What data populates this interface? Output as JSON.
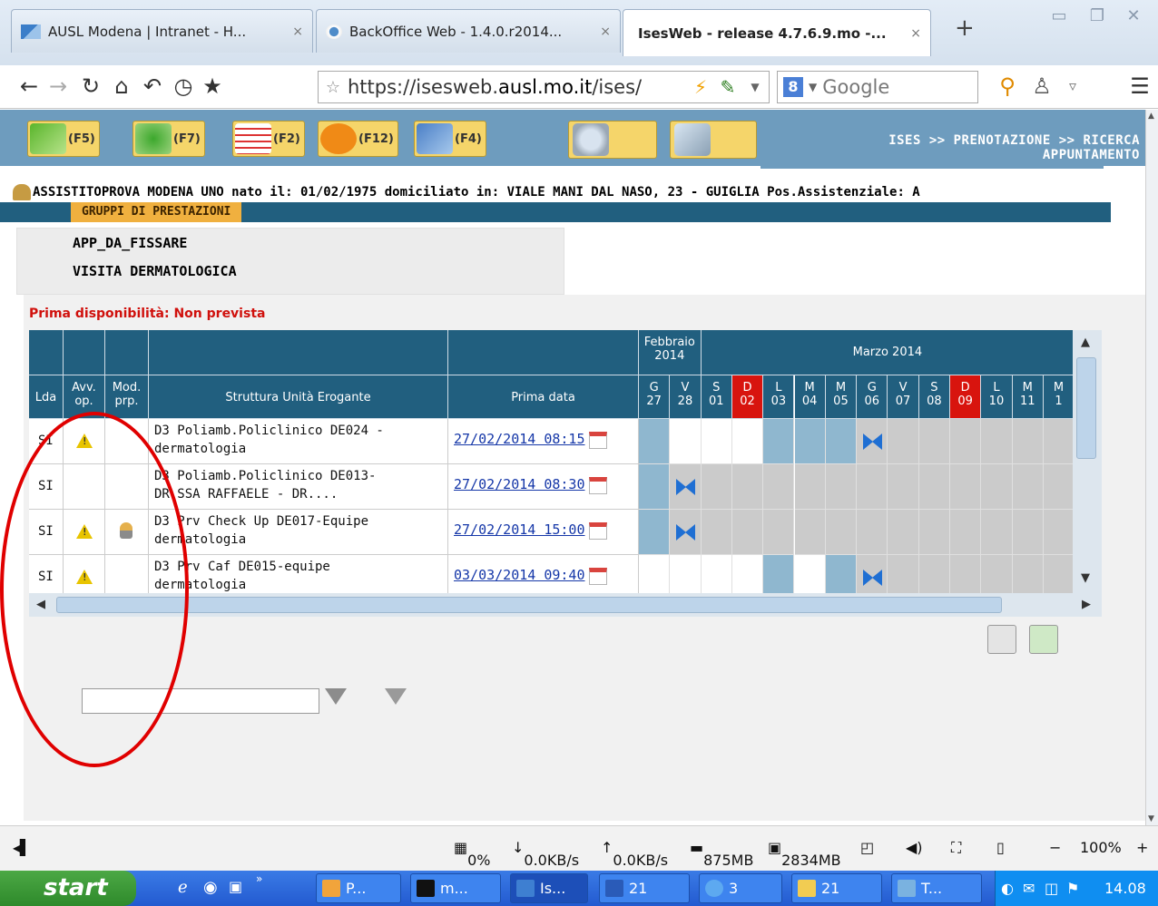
{
  "browser": {
    "tabs": [
      {
        "label": "AUSL Modena | Intranet - H...",
        "close": "×"
      },
      {
        "label": "BackOffice Web - 1.4.0.r2014...",
        "close": "×"
      },
      {
        "label": "IsesWeb - release 4.7.6.9.mo -...",
        "close": "×"
      }
    ],
    "new_tab": "+",
    "url_prefix": "https://isesweb.",
    "url_domain": "ausl.mo.it",
    "url_suffix": "/ises/",
    "search_engine": "8",
    "search_placeholder": "Google"
  },
  "app": {
    "function_keys": [
      "(F5)",
      "(F7)",
      "(F2)",
      "(F12)",
      "(F4)"
    ],
    "breadcrumb_line1": "ISES >> PRENOTAZIONE >> RICERCA",
    "breadcrumb_line2": "APPUNTAMENTO",
    "patient_info": "ASSISTITOPROVA MODENA UNO nato il: 01/02/1975 domiciliato in: VIALE MANI DAL NASO, 23 - GUIGLIA Pos.Assistenziale: A",
    "gruppi_label": "GRUPPI DI PRESTAZIONI",
    "prestazioni": [
      "APP_DA_FISSARE",
      "VISITA DERMATOLOGICA"
    ],
    "prima_disponibilita": "Prima disponibilità: Non prevista"
  },
  "grid": {
    "headers": {
      "lda": "Lda",
      "avv_1": "Avv.",
      "avv_2": "op.",
      "mod_1": "Mod.",
      "mod_2": "prp.",
      "struttura": "Struttura Unità Erogante",
      "prima_data": "Prima data",
      "month_feb_1": "Febbraio",
      "month_feb_2": "2014",
      "month_mar": "Marzo 2014"
    },
    "days": [
      {
        "dow": "G",
        "day": "27",
        "holiday": false
      },
      {
        "dow": "V",
        "day": "28",
        "holiday": false
      },
      {
        "dow": "S",
        "day": "01",
        "holiday": false
      },
      {
        "dow": "D",
        "day": "02",
        "holiday": true
      },
      {
        "dow": "L",
        "day": "03",
        "holiday": false
      },
      {
        "dow": "M",
        "day": "04",
        "holiday": false
      },
      {
        "dow": "M",
        "day": "05",
        "holiday": false
      },
      {
        "dow": "G",
        "day": "06",
        "holiday": false
      },
      {
        "dow": "V",
        "day": "07",
        "holiday": false
      },
      {
        "dow": "S",
        "day": "08",
        "holiday": false
      },
      {
        "dow": "D",
        "day": "09",
        "holiday": true
      },
      {
        "dow": "L",
        "day": "10",
        "holiday": false
      },
      {
        "dow": "M",
        "day": "11",
        "holiday": false
      },
      {
        "dow": "M",
        "day": "1",
        "holiday": false
      }
    ],
    "rows": [
      {
        "lda": "SI",
        "warning": true,
        "mod": false,
        "struttura_1": "D3 Poliamb.Policlinico DE024 -",
        "struttura_2": "dermatologia",
        "prima_data": "27/02/2014 08:15",
        "cal": [
          "blue",
          "white",
          "white",
          "white",
          "blue",
          "blue",
          "blue",
          "slot",
          "gray",
          "gray",
          "gray",
          "gray",
          "gray",
          "gray"
        ]
      },
      {
        "lda": "SI",
        "warning": false,
        "mod": false,
        "struttura_1": "D3 Poliamb.Policlinico DE013-",
        "struttura_2": "DR.SSA RAFFAELE - DR....",
        "prima_data": "27/02/2014 08:30",
        "cal": [
          "blue",
          "slot",
          "gray",
          "gray",
          "gray",
          "gray",
          "gray",
          "gray",
          "gray",
          "gray",
          "gray",
          "gray",
          "gray",
          "gray"
        ]
      },
      {
        "lda": "SI",
        "warning": true,
        "mod": true,
        "struttura_1": "D3 Prv Check Up DE017-Equipe",
        "struttura_2": "dermatologia",
        "prima_data": "27/02/2014 15:00",
        "cal": [
          "blue",
          "slot",
          "gray",
          "gray",
          "gray",
          "gray",
          "gray",
          "gray",
          "gray",
          "gray",
          "gray",
          "gray",
          "gray",
          "gray"
        ]
      },
      {
        "lda": "SI",
        "warning": true,
        "mod": false,
        "struttura_1": "D3 Prv Caf DE015-equipe",
        "struttura_2": "dermatologia",
        "prima_data": "03/03/2014 09:40",
        "cal": [
          "white",
          "white",
          "white",
          "white",
          "blue",
          "white",
          "blue",
          "slot",
          "gray",
          "gray",
          "gray",
          "gray",
          "gray",
          "gray"
        ]
      }
    ]
  },
  "statusbar": {
    "cpu": "0%",
    "down": "0.0KB/s",
    "up": "0.0KB/s",
    "mem": "875MB",
    "disk": "2834MB",
    "zoom": "100%",
    "minus": "−",
    "plus": "+"
  },
  "taskbar": {
    "start": "start",
    "buttons": [
      "P...",
      "m...",
      "Is...",
      "21",
      "3",
      "21",
      "T..."
    ],
    "clock": "14.08"
  }
}
